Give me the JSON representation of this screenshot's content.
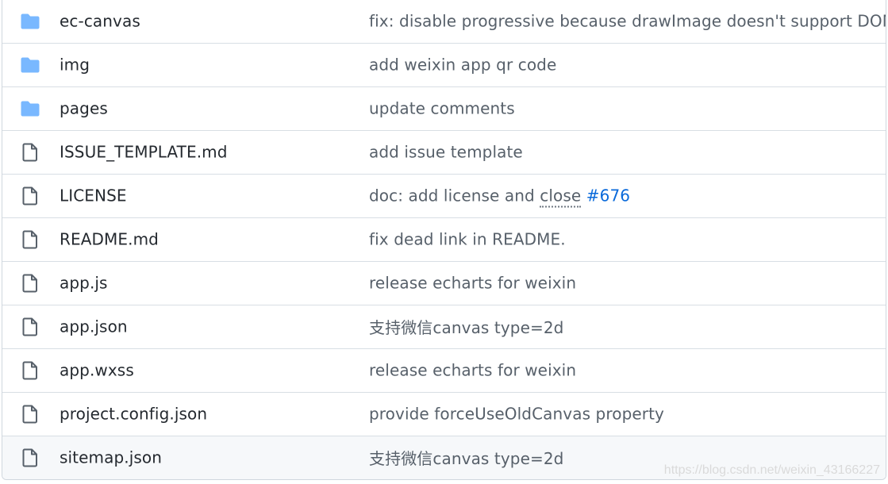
{
  "colors": {
    "folder_icon": "#79b8ff",
    "file_icon": "#57606a",
    "name_text": "#24292f",
    "message_text": "#57606a",
    "link": "#0969da",
    "border": "#d8dee4",
    "hover_row_bg": "#f6f8fa"
  },
  "files": [
    {
      "name": "ec-canvas",
      "type": "folder",
      "icon": "folder-icon",
      "message": "fix: disable progressive because drawImage doesn't support DOM"
    },
    {
      "name": "img",
      "type": "folder",
      "icon": "folder-icon",
      "message": "add weixin app qr code"
    },
    {
      "name": "pages",
      "type": "folder",
      "icon": "folder-icon",
      "message": "update comments"
    },
    {
      "name": "ISSUE_TEMPLATE.md",
      "type": "file",
      "icon": "file-icon",
      "message": "add issue template"
    },
    {
      "name": "LICENSE",
      "type": "file",
      "icon": "file-icon",
      "message_prefix": "doc: add license and ",
      "message_close": "close",
      "message_space": " ",
      "message_link": "#676"
    },
    {
      "name": "README.md",
      "type": "file",
      "icon": "file-icon",
      "message": "fix dead link in README."
    },
    {
      "name": "app.js",
      "type": "file",
      "icon": "file-icon",
      "message": "release echarts for weixin"
    },
    {
      "name": "app.json",
      "type": "file",
      "icon": "file-icon",
      "message": "支持微信canvas type=2d"
    },
    {
      "name": "app.wxss",
      "type": "file",
      "icon": "file-icon",
      "message": "release echarts for weixin"
    },
    {
      "name": "project.config.json",
      "type": "file",
      "icon": "file-icon",
      "message": "provide forceUseOldCanvas property"
    },
    {
      "name": "sitemap.json",
      "type": "file",
      "icon": "file-icon",
      "message": "支持微信canvas type=2d"
    }
  ],
  "watermark": "https://blog.csdn.net/weixin_43166227"
}
